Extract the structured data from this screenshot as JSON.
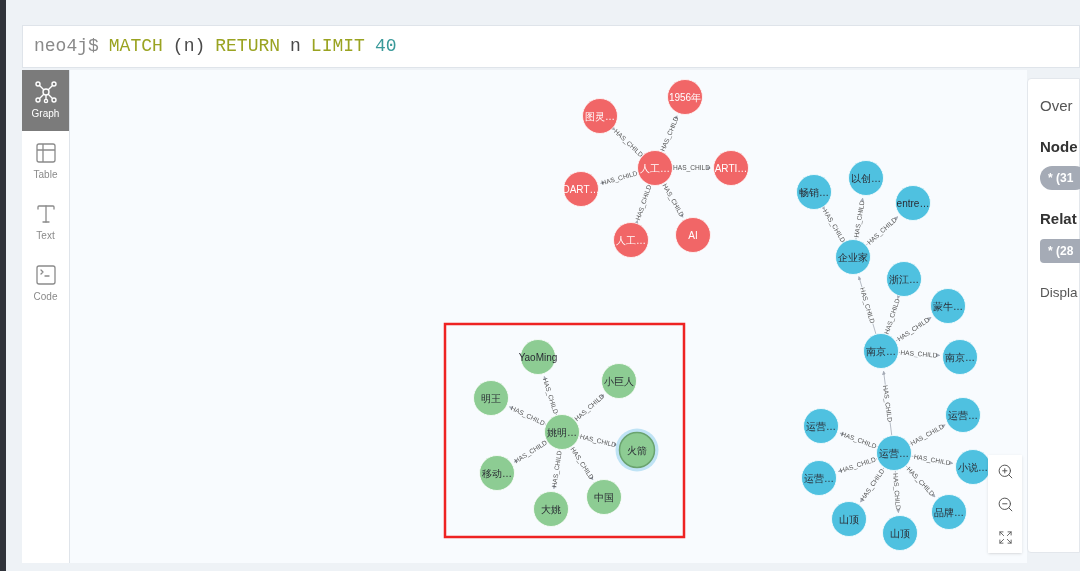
{
  "query": {
    "prompt": "neo4j$",
    "tokens": [
      {
        "text": "MATCH",
        "kind": "keyword"
      },
      {
        "text": "(n)",
        "kind": "plain"
      },
      {
        "text": "RETURN",
        "kind": "keyword"
      },
      {
        "text": "n",
        "kind": "plain"
      },
      {
        "text": "LIMIT",
        "kind": "keyword"
      },
      {
        "text": "40",
        "kind": "number"
      }
    ]
  },
  "view_tabs": [
    {
      "label": "Graph",
      "kind": "graph",
      "selected": true
    },
    {
      "label": "Table",
      "kind": "table",
      "selected": false
    },
    {
      "label": "Text",
      "kind": "text",
      "selected": false
    },
    {
      "label": "Code",
      "kind": "code",
      "selected": false
    }
  ],
  "graph": {
    "clusters": [
      {
        "color": "#f16667",
        "root": {
          "label": "人工…",
          "selected": false,
          "children": [
            {
              "label": "1956年",
              "selected": false,
              "relationship": "HAS_CHILD"
            },
            {
              "label": "图灵…",
              "selected": false,
              "relationship": "HAS_CHILD"
            },
            {
              "label": "ARTI…",
              "selected": false,
              "relationship": "HAS_CHILD"
            },
            {
              "label": "DART…",
              "selected": false,
              "relationship": "HAS_CHILD"
            },
            {
              "label": "人工…",
              "selected": false,
              "relationship": "HAS_CHILD"
            },
            {
              "label": "AI",
              "selected": false,
              "relationship": "HAS_CHILD"
            }
          ]
        }
      },
      {
        "color": "#8dcc93",
        "root": {
          "label": "姚明…",
          "selected": false,
          "children": [
            {
              "label": "YaoMing",
              "selected": false,
              "relationship": "HAS_CHILD"
            },
            {
              "label": "小巨人",
              "selected": false,
              "relationship": "HAS_CHILD"
            },
            {
              "label": "明王",
              "selected": false,
              "relationship": "HAS_CHILD"
            },
            {
              "label": "火箭",
              "selected": true,
              "relationship": "HAS_CHILD"
            },
            {
              "label": "移动…",
              "selected": false,
              "relationship": "HAS_CHILD"
            },
            {
              "label": "大姚",
              "selected": false,
              "relationship": "HAS_CHILD"
            },
            {
              "label": "中国",
              "selected": false,
              "relationship": "HAS_CHILD"
            }
          ]
        }
      },
      {
        "color": "#4fc1e0",
        "root": {
          "label": "运营…",
          "selected": false,
          "children": [
            {
              "label": "运营…",
              "selected": false,
              "relationship": "HAS_CHILD"
            },
            {
              "label": "运营…",
              "selected": false,
              "relationship": "HAS_CHILD"
            },
            {
              "label": "小说…",
              "selected": false,
              "relationship": "HAS_CHILD"
            },
            {
              "label": "运营…",
              "selected": false,
              "relationship": "HAS_CHILD"
            },
            {
              "label": "品牌…",
              "selected": false,
              "relationship": "HAS_CHILD"
            },
            {
              "label": "山顶",
              "selected": false,
              "relationship": "HAS_CHILD"
            },
            {
              "label": "山顶",
              "selected": false,
              "relationship": "HAS_CHILD"
            },
            {
              "label": "南京…",
              "selected": false,
              "relationship": "HAS_CHILD",
              "children": [
                {
                  "label": "浙江…",
                  "selected": false,
                  "relationship": "HAS_CHILD"
                },
                {
                  "label": "蒙牛…",
                  "selected": false,
                  "relationship": "HAS_CHILD"
                },
                {
                  "label": "南京…",
                  "selected": false,
                  "relationship": "HAS_CHILD"
                },
                {
                  "label": "企业家",
                  "selected": false,
                  "relationship": "HAS_CHILD",
                  "children": [
                    {
                      "label": "畅销…",
                      "selected": false,
                      "relationship": "HAS_CHILD"
                    },
                    {
                      "label": "以创…",
                      "selected": false,
                      "relationship": "HAS_CHILD"
                    },
                    {
                      "label": "entre…",
                      "selected": false,
                      "relationship": "HAS_CHILD"
                    }
                  ]
                }
              ]
            }
          ]
        }
      }
    ]
  },
  "overview": {
    "title": "Over",
    "node_heading": "Node",
    "node_pill": "* (31",
    "relationship_heading": "Relat",
    "relationship_pill": "* (28",
    "display_text": "Displa"
  }
}
